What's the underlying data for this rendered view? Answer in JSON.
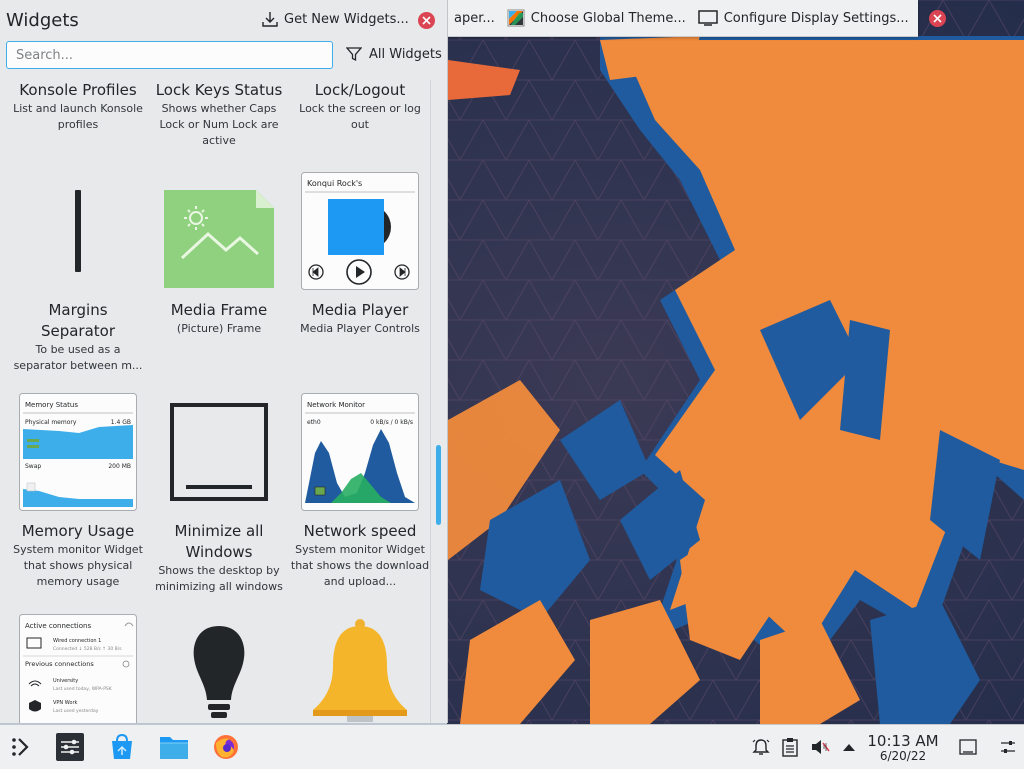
{
  "topbar": {
    "wallpaper_fragment": "aper...",
    "global_theme_label": "Choose Global Theme...",
    "display_settings_label": "Configure Display Settings..."
  },
  "explorer": {
    "title": "Widgets",
    "get_new_label": "Get New Widgets...",
    "search_placeholder": "Search...",
    "filter_label": "All Widgets",
    "widgets": [
      {
        "name": "Konsole Profiles",
        "desc": "List and launch Konsole profiles"
      },
      {
        "name": "Lock Keys Status",
        "desc": "Shows whether Caps Lock or Num Lock are active"
      },
      {
        "name": "Lock/Logout",
        "desc": "Lock the screen or log out"
      },
      {
        "name": "Margins Separator",
        "desc": "To be used as a separator between m..."
      },
      {
        "name": "Media Frame",
        "desc": "(Picture) Frame"
      },
      {
        "name": "Media Player",
        "desc": "Media Player Controls"
      },
      {
        "name": "Memory Usage",
        "desc": "System monitor Widget that shows physical memory usage"
      },
      {
        "name": "Minimize all Windows",
        "desc": "Shows the desktop by minimizing all windows"
      },
      {
        "name": "Network speed",
        "desc": "System monitor Widget that shows the download and upload..."
      }
    ],
    "previews": {
      "media_player": {
        "track": "Konqui Rock's"
      },
      "memory": {
        "title": "Memory Status",
        "physical": "Physical memory",
        "physical_val": "1.4 GB",
        "swap": "Swap",
        "swap_val": "200 MB"
      },
      "network": {
        "title": "Network Monitor",
        "iface": "eth0",
        "rate": "0 kB/s / 0 kB/s"
      },
      "connections": {
        "title": "Active connections",
        "wired": "Wired connection 1",
        "wired_sub": "Connected ↓ 528 B/s ↑ 30 B/s",
        "previous": "Previous connections",
        "wifi": "University",
        "wifi_sub": "Last used today, WPA-PSK",
        "vpn": "VPN Work",
        "vpn_sub": "Last used yesterday"
      }
    }
  },
  "panel": {
    "time": "10:13 AM",
    "date": "6/20/22"
  },
  "colors": {
    "accent": "#3daee9",
    "close": "#da4453",
    "panel": "#eff0f1",
    "wallpaper_orange": "#f08a3c",
    "wallpaper_blue": "#1f5b9e"
  }
}
